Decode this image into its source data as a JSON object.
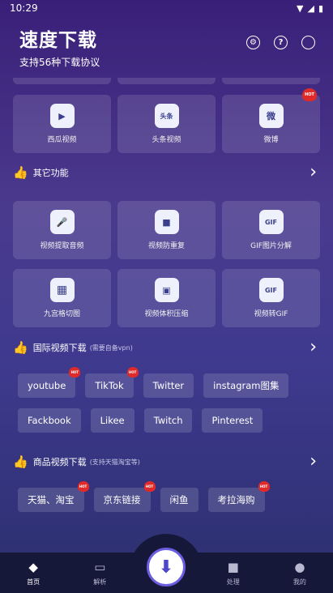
{
  "status": {
    "time": "10:29"
  },
  "header": {
    "title": "速度下载",
    "subtitle": "支持56种下载协议"
  },
  "top_tiles": [
    {
      "label": "西瓜视频",
      "icon": "▶"
    },
    {
      "label": "头条视频",
      "icon": "头条"
    },
    {
      "label": "微博",
      "icon": "微",
      "badge": "HOT"
    }
  ],
  "other": {
    "title": "其它功能",
    "row1": [
      {
        "label": "视频提取音频",
        "icon": "🎤"
      },
      {
        "label": "视频防重复",
        "icon": "■"
      },
      {
        "label": "GIF图片分解",
        "icon": "GIF"
      }
    ],
    "row2": [
      {
        "label": "九宫格切图",
        "icon": "▦"
      },
      {
        "label": "视频体积压缩",
        "icon": "▣"
      },
      {
        "label": "视频转GIF",
        "icon": "GIF"
      }
    ]
  },
  "intl": {
    "title": "国际视频下载",
    "hint": "(需要自备vpn)",
    "row1": [
      "youtube",
      "TikTok",
      "Twitter",
      "instagram图集"
    ],
    "row2": [
      "Fackbook",
      "Likee",
      "Twitch",
      "Pinterest"
    ]
  },
  "shop": {
    "title": "商品视频下载",
    "hint": "(支持天猫淘宝等)",
    "items": [
      "天猫、淘宝",
      "京东链接",
      "闲鱼",
      "考拉海购"
    ]
  },
  "nav": {
    "home": "首页",
    "parse": "解析",
    "process": "处理",
    "mine": "我的"
  },
  "badge_text": "HOT"
}
